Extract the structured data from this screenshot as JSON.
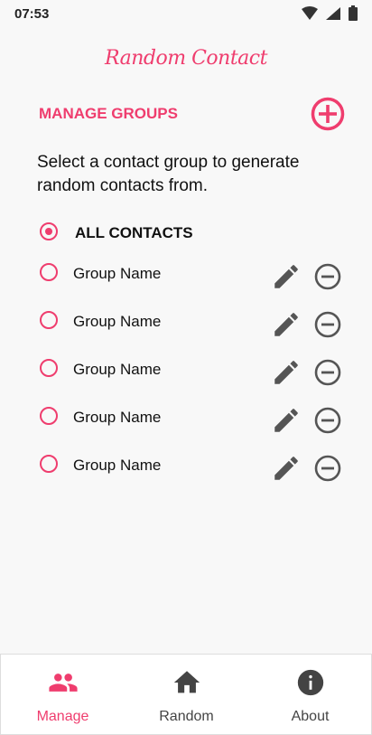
{
  "status": {
    "time": "07:53"
  },
  "app": {
    "title": "Random Contact",
    "accent": "#ef3d6e"
  },
  "section": {
    "header": "MANAGE GROUPS",
    "add_icon": "add-circle-icon"
  },
  "instructions": "Select a contact group to generate random contacts from.",
  "all_contacts": {
    "label": "ALL CONTACTS",
    "selected": true
  },
  "groups": [
    {
      "name": "Group Name"
    },
    {
      "name": "Group Name"
    },
    {
      "name": "Group Name"
    },
    {
      "name": "Group Name"
    },
    {
      "name": "Group Name"
    }
  ],
  "nav": {
    "items": [
      {
        "label": "Manage",
        "icon": "people-icon",
        "active": true
      },
      {
        "label": "Random",
        "icon": "home-icon",
        "active": false
      },
      {
        "label": "About",
        "icon": "info-icon",
        "active": false
      }
    ]
  }
}
